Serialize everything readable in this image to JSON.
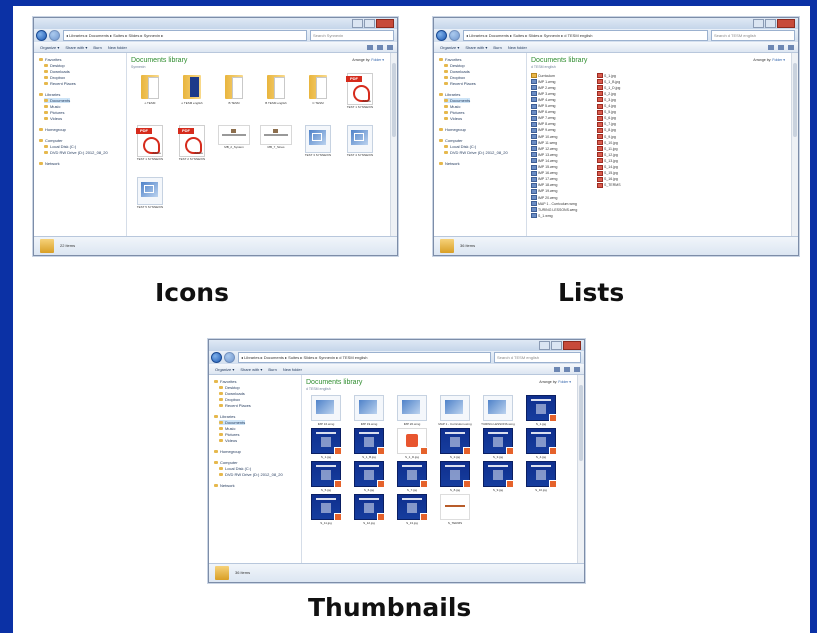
{
  "captions": {
    "icons": "Icons",
    "lists": "Lists",
    "thumbnails": "Thumbnails"
  },
  "colors": {
    "frame_blue": "#0b31a5",
    "library_green": "#2f8d2f"
  },
  "windows": {
    "icons": {
      "address": "◂ Libraries ▸ Documents ▸ Suites ▸ Slides ▸ Synnexin ▸",
      "search_placeholder": "Search Synnexin",
      "toolbar": [
        "Organize ▾",
        "Share with ▾",
        "Burn",
        "New folder"
      ],
      "library_title": "Documents library",
      "library_sub": "Synnexin",
      "arrange_by_label": "Arrange by:",
      "arrange_by_value": "Folder ▾",
      "details": "22 items",
      "nav": [
        "Favorites",
        "Desktop",
        "Downloads",
        "Dropbox",
        "Recent Places",
        "",
        "Libraries",
        "Documents",
        "Music",
        "Pictures",
        "Videos",
        "",
        "Homegroup",
        "",
        "Computer",
        "Local Disk (C:)",
        "DVD RW Drive (D:) 2012_08_20",
        "",
        "Network"
      ],
      "icons": [
        {
          "type": "folder",
          "label": "o TESM"
        },
        {
          "type": "folder-blue",
          "label": "o TESM english"
        },
        {
          "type": "folder",
          "label": "B TESM"
        },
        {
          "type": "folder",
          "label": "B TESM english"
        },
        {
          "type": "folder",
          "label": "C TESM"
        },
        {
          "type": "pdf",
          "label": "TEST 1 SYNNEXIN"
        },
        {
          "type": "pdf",
          "label": "TEST 1 SYNNEXIN"
        },
        {
          "type": "pdf",
          "label": "TEST 2 SYNNEXIN"
        },
        {
          "type": "jpg",
          "label": "MB_2_System"
        },
        {
          "type": "jpg",
          "label": "MB_7_Sines"
        },
        {
          "type": "img",
          "label": "TEST 3 SYNNEXIN"
        },
        {
          "type": "img",
          "label": "TEST 4 SYNNEXIN"
        },
        {
          "type": "img",
          "label": "TEST 5 SYNNEXIN"
        }
      ]
    },
    "lists": {
      "address": "◂ Libraries ▸ Documents ▸ Suites ▸ Slides ▸ Synnexin ▸ d TESM english",
      "search_placeholder": "Search d TESM english",
      "toolbar": [
        "Organize ▾",
        "Share with ▾",
        "Burn",
        "New folder"
      ],
      "library_title": "Documents library",
      "library_sub": "d TESM english",
      "arrange_by_label": "Arrange by:",
      "arrange_by_value": "Folder ▾",
      "details": "36 items",
      "nav": [
        "Favorites",
        "Desktop",
        "Downloads",
        "Dropbox",
        "Recent Places",
        "",
        "Libraries",
        "Documents",
        "Music",
        "Pictures",
        "Videos",
        "",
        "Homegroup",
        "",
        "Computer",
        "Local Disk (C:)",
        "DVD RW Drive (D:) 2012_08_20",
        "",
        "Network"
      ],
      "col1": [
        "Curriculum",
        "IMP 1.wmg",
        "IMP 2.wmg",
        "IMP 3.wmg",
        "IMP 4.wmg",
        "IMP 5.wmg",
        "IMP 6.wmg",
        "IMP 7.wmg",
        "IMP 8.wmg",
        "IMP 9.wmg",
        "IMP 10.wmg",
        "IMP 11.wmg",
        "IMP 12.wmg",
        "IMP 13.wmg",
        "IMP 14.wmg",
        "IMP 15.wmg",
        "IMP 16.wmg",
        "IMP 17.wmg",
        "IMP 18.wmg",
        "IMP 19.wmg",
        "IMP 20.wmg",
        "MAP 1 - Curriculum.wmg",
        "TURING LESSONS.wmg",
        "S_1.wmg"
      ],
      "col2": [
        "S_1.jpg",
        "S_1_B.jpg",
        "S_1_D.jpg",
        "S_2.jpg",
        "S_3.jpg",
        "S_4.jpg",
        "S_5.jpg",
        "S_6.jpg",
        "S_7.jpg",
        "S_8.jpg",
        "S_9.jpg",
        "S_10.jpg",
        "S_11.jpg",
        "S_12.jpg",
        "S_13.jpg",
        "S_14.jpg",
        "S_15.jpg",
        "S_16.jpg",
        "S_TERMS"
      ]
    },
    "thumbnails": {
      "address": "◂ Libraries ▸ Documents ▸ Suites ▸ Slides ▸ Synnexin ▸ d TESM english",
      "search_placeholder": "Search d TESM english",
      "toolbar": [
        "Organize ▾",
        "Share with ▾",
        "Burn",
        "New folder"
      ],
      "library_title": "Documents library",
      "library_sub": "d TESM english",
      "arrange_by_label": "Arrange by:",
      "arrange_by_value": "Folder ▾",
      "details": "36 items",
      "nav": [
        "Favorites",
        "Desktop",
        "Downloads",
        "Dropbox",
        "Recent Places",
        "",
        "Libraries",
        "Documents",
        "Music",
        "Pictures",
        "Videos",
        "",
        "Homegroup",
        "",
        "Computer",
        "Local Disk (C:)",
        "DVD RW Drive (D:) 2012_08_20",
        "",
        "Network"
      ],
      "thumbs": [
        {
          "type": "doc",
          "label": "IMP 16.wmg"
        },
        {
          "type": "doc",
          "label": "IMP 19.wmg"
        },
        {
          "type": "doc",
          "label": "IMP 20.wmg"
        },
        {
          "type": "doc",
          "label": "MAP 1 - Curriculum.wmg"
        },
        {
          "type": "doc",
          "label": "TURING LESSONS.wmg"
        },
        {
          "type": "dark",
          "label": "S_1.jpg"
        },
        {
          "type": "dark",
          "label": "S_1.jpg"
        },
        {
          "type": "dark",
          "label": "S_1_B.jpg"
        },
        {
          "type": "ppt",
          "label": "S_1_D.jpg"
        },
        {
          "type": "dark",
          "label": "S_2.jpg"
        },
        {
          "type": "dark",
          "label": "S_3.jpg"
        },
        {
          "type": "dark",
          "label": "S_4.jpg"
        },
        {
          "type": "dark",
          "label": "S_5.jpg"
        },
        {
          "type": "dark",
          "label": "S_6.jpg"
        },
        {
          "type": "dark",
          "label": "S_7.jpg"
        },
        {
          "type": "dark",
          "label": "S_8.jpg"
        },
        {
          "type": "dark",
          "label": "S_9.jpg"
        },
        {
          "type": "dark",
          "label": "S_10.jpg"
        },
        {
          "type": "dark",
          "label": "S_11.jpg"
        },
        {
          "type": "dark",
          "label": "S_12.jpg"
        },
        {
          "type": "dark",
          "label": "S_13.jpg"
        },
        {
          "type": "white",
          "label": "S_TERMS"
        }
      ]
    }
  }
}
